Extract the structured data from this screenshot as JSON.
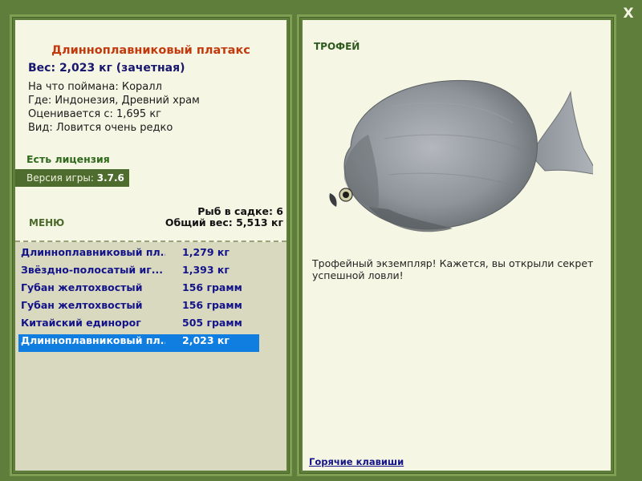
{
  "close_label": "X",
  "fish": {
    "title": "Длиннoплавниковый платакс",
    "weight": "Вес: 2,023 кг (зачетная)",
    "details": [
      "На что поймана: Коралл",
      "Где: Индонезия, Древний храм",
      "Оценивается с: 1,695 кг",
      "Вид: Ловится очень редко"
    ]
  },
  "license": "Есть лицензия",
  "version": {
    "label": "Версия игры:",
    "value": "3.7.6"
  },
  "menu_label": "МЕНЮ",
  "keepnet": {
    "count": "Рыб в садке: 6",
    "total": "Общий вес: 5,513 кг"
  },
  "catches": [
    {
      "name": "Длиннoплавниковый пл...",
      "weight": "1,279 кг"
    },
    {
      "name": "Звёздно-полосатый иг...",
      "weight": "1,393 кг"
    },
    {
      "name": "Губан желтохвостый",
      "weight": "156 грамм"
    },
    {
      "name": "Губан желтохвостый",
      "weight": "156 грамм"
    },
    {
      "name": "Китайский единорог",
      "weight": "505 грамм"
    },
    {
      "name": "Длиннoплавниковый пл...",
      "weight": "2,023 кг",
      "selected": true
    }
  ],
  "trophy_label": "ТРОФЕЙ",
  "description": "Трофейный экземпляр! Кажется, вы открыли секрет успешной ловли!",
  "hotkeys_label": "Горячие клавиши",
  "colors": {
    "background": "#5f7e3c",
    "panel": "#f6f6e4",
    "list_bg": "#d9d9c0",
    "selected_row": "#0f7ee0",
    "title": "#c23a0e"
  }
}
